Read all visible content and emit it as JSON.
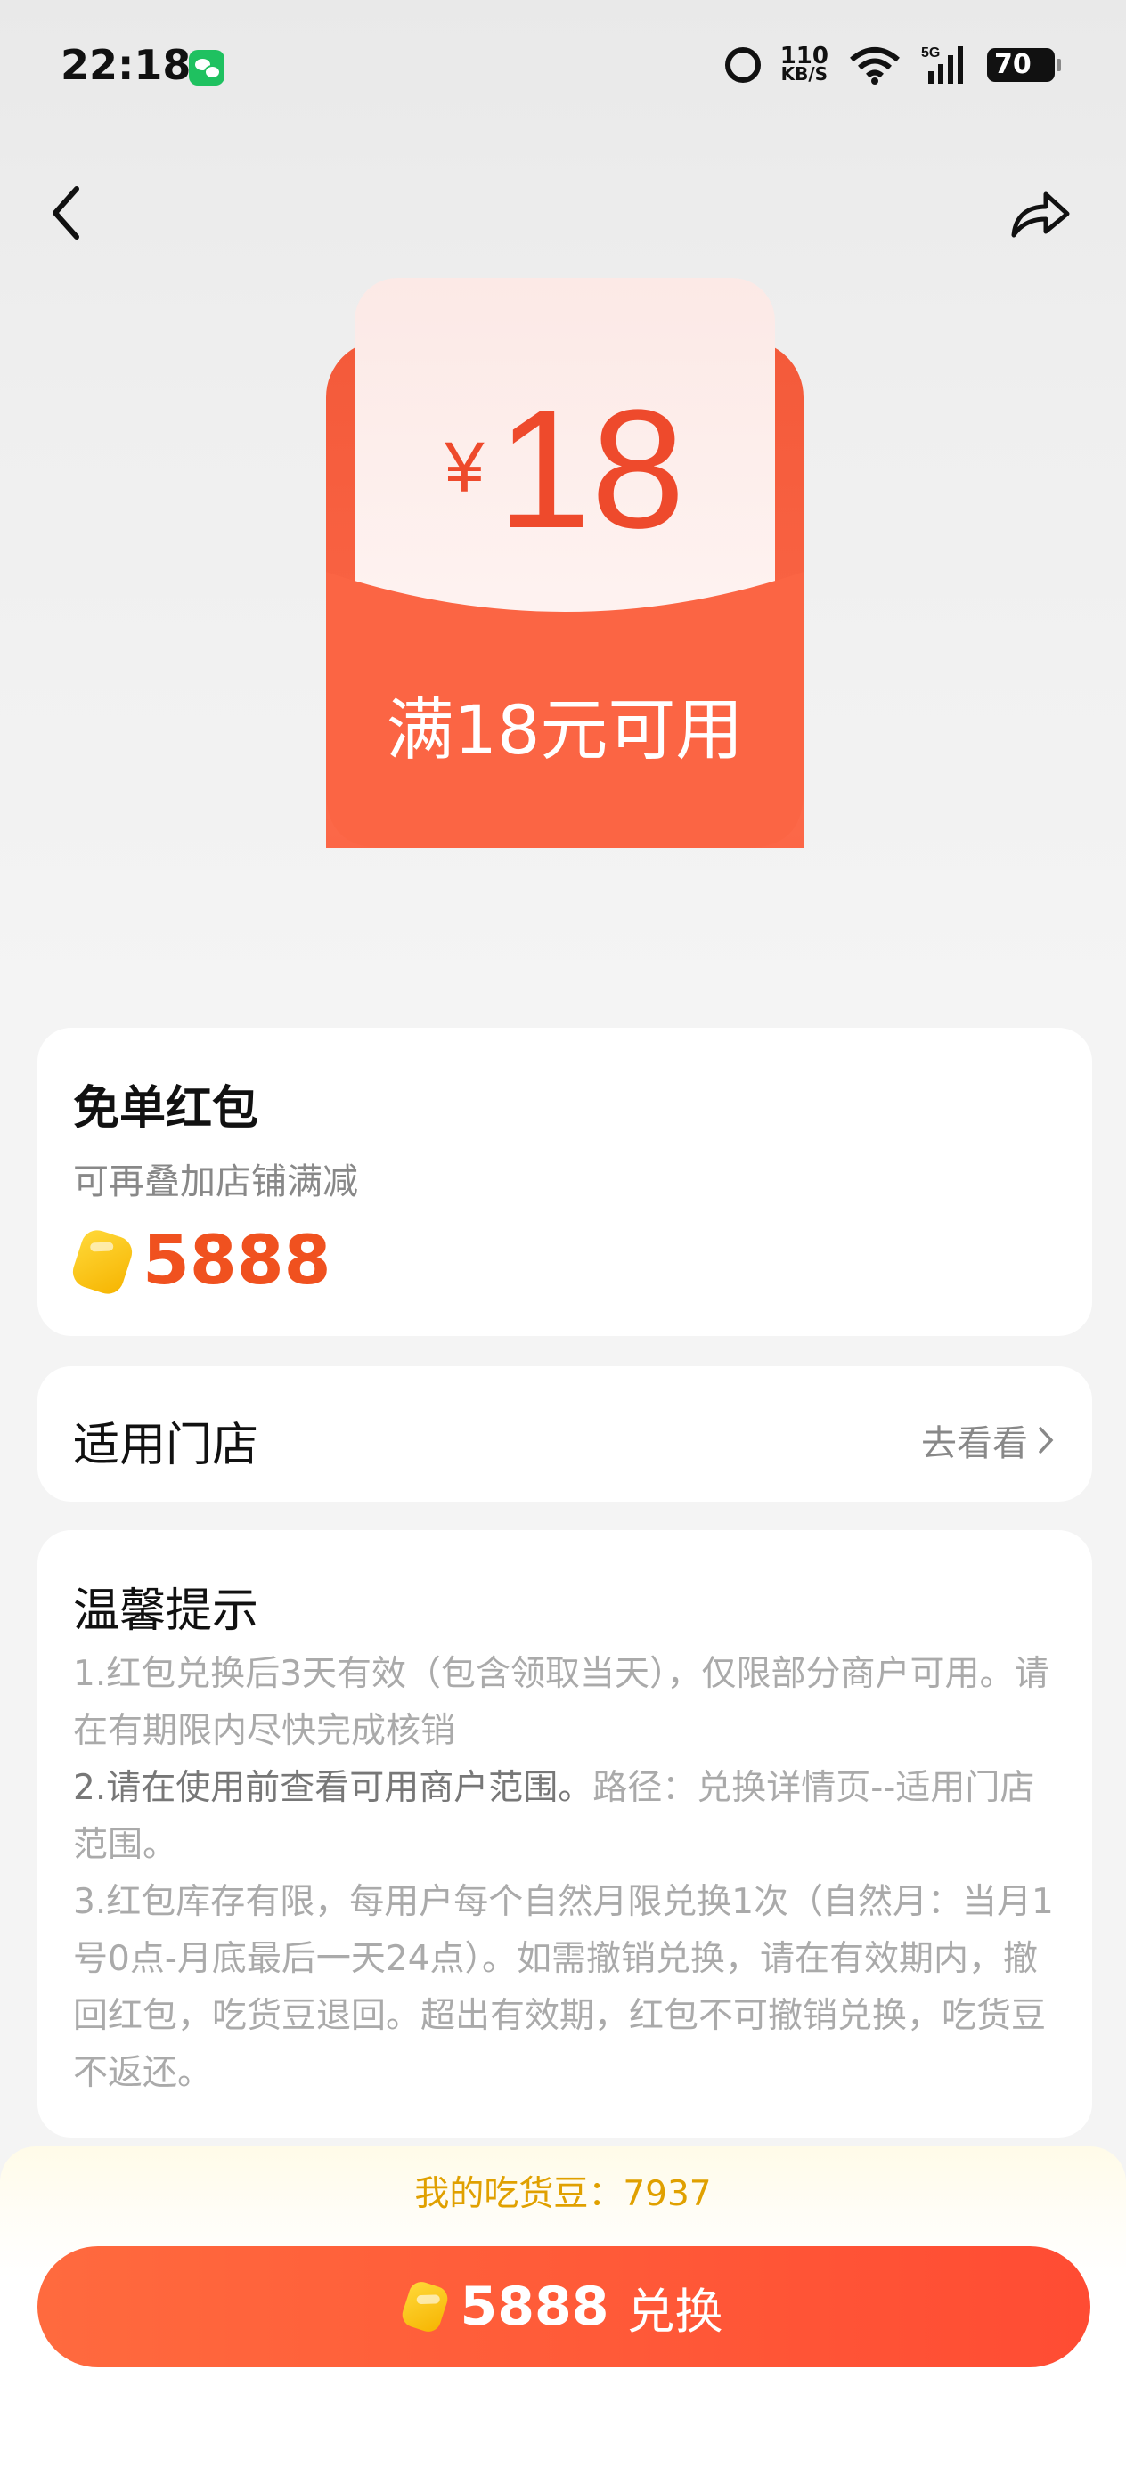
{
  "status_bar": {
    "time": "22:18",
    "net_speed_value": "110",
    "net_speed_unit": "KB/S",
    "battery": "70",
    "icons": [
      "wechat-icon",
      "alarm-icon",
      "wifi-icon",
      "5g-signal-icon",
      "battery-icon"
    ]
  },
  "nav": {
    "back_icon": "chevron-left-icon",
    "share_icon": "share-icon"
  },
  "coupon": {
    "currency": "¥",
    "amount": "18",
    "condition": "满18元可用"
  },
  "product": {
    "title": "免单红包",
    "subtitle": "可再叠加店铺满减",
    "price": "5888"
  },
  "stores": {
    "title": "适用门店",
    "link_label": "去看看"
  },
  "tips": {
    "title": "温馨提示",
    "line1": "1.红包兑换后3天有效（包含领取当天），仅限部分商户可用。请在有期限内尽快完成核销",
    "line2_highlight": "2.请在使用前查看可用商户范围。",
    "line2_rest": "路径：兑换详情页--适用门店范围。",
    "line3": "3.红包库存有限，每用户每个自然月限兑换1次（自然月：当月1号0点-月底最后一天24点）。如需撤销兑换，请在有效期内，撤回红包，吃货豆退回。超出有效期，红包不可撤销兑换，吃货豆不返还。"
  },
  "footer": {
    "my_beans": "我的吃货豆：7937",
    "button_cost": "5888",
    "button_label": "兑换"
  },
  "colors": {
    "accent": "#f0511f",
    "button": "#ff5a38",
    "bean": "#f6b400"
  }
}
